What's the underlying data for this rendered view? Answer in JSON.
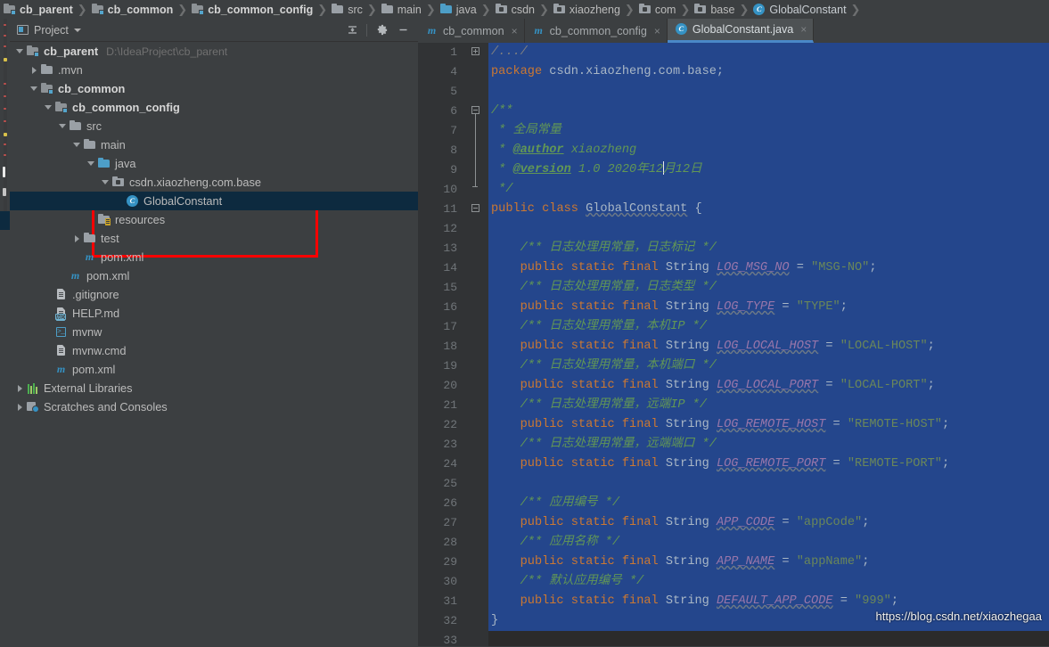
{
  "breadcrumb": {
    "items": [
      {
        "label": "cb_parent",
        "icon": "module-folder-icon",
        "bold": true
      },
      {
        "label": "cb_common",
        "icon": "module-folder-icon",
        "bold": true
      },
      {
        "label": "cb_common_config",
        "icon": "module-folder-icon",
        "bold": true
      },
      {
        "label": "src",
        "icon": "folder-icon",
        "bold": false
      },
      {
        "label": "main",
        "icon": "folder-icon",
        "bold": false
      },
      {
        "label": "java",
        "icon": "source-root-folder-icon",
        "bold": false
      },
      {
        "label": "csdn",
        "icon": "package-icon",
        "bold": false
      },
      {
        "label": "xiaozheng",
        "icon": "package-icon",
        "bold": false
      },
      {
        "label": "com",
        "icon": "package-icon",
        "bold": false
      },
      {
        "label": "base",
        "icon": "package-icon",
        "bold": false
      },
      {
        "label": "GlobalConstant",
        "icon": "class-icon",
        "bold": false
      }
    ],
    "separator": "❯"
  },
  "project_panel": {
    "title": "Project",
    "toolbar": [
      {
        "name": "collapse-all-button",
        "tooltip": "Collapse All"
      },
      {
        "name": "settings-gear-button",
        "tooltip": "Settings"
      },
      {
        "name": "hide-panel-button",
        "tooltip": "Hide"
      }
    ],
    "tree": [
      {
        "label": "cb_parent",
        "secondary": "D:\\IdeaProject\\cb_parent",
        "indent": 0,
        "arrow": "down",
        "icon": "module-folder-icon",
        "bold": true,
        "selected": false
      },
      {
        "label": ".mvn",
        "secondary": "",
        "indent": 1,
        "arrow": "right",
        "icon": "folder-icon",
        "bold": false,
        "selected": false
      },
      {
        "label": "cb_common",
        "secondary": "",
        "indent": 1,
        "arrow": "down",
        "icon": "module-folder-icon",
        "bold": true,
        "selected": false
      },
      {
        "label": "cb_common_config",
        "secondary": "",
        "indent": 2,
        "arrow": "down",
        "icon": "module-folder-icon",
        "bold": true,
        "selected": false
      },
      {
        "label": "src",
        "secondary": "",
        "indent": 3,
        "arrow": "down",
        "icon": "folder-icon",
        "bold": false,
        "selected": false
      },
      {
        "label": "main",
        "secondary": "",
        "indent": 4,
        "arrow": "down",
        "icon": "folder-icon",
        "bold": false,
        "selected": false
      },
      {
        "label": "java",
        "secondary": "",
        "indent": 5,
        "arrow": "down",
        "icon": "source-root-folder-icon",
        "bold": false,
        "selected": false
      },
      {
        "label": "csdn.xiaozheng.com.base",
        "secondary": "",
        "indent": 6,
        "arrow": "down",
        "icon": "package-icon",
        "bold": false,
        "selected": false
      },
      {
        "label": "GlobalConstant",
        "secondary": "",
        "indent": 7,
        "arrow": "none",
        "icon": "class-icon",
        "bold": false,
        "selected": true
      },
      {
        "label": "resources",
        "secondary": "",
        "indent": 5,
        "arrow": "none",
        "icon": "resource-root-folder-icon",
        "bold": false,
        "selected": false
      },
      {
        "label": "test",
        "secondary": "",
        "indent": 4,
        "arrow": "right",
        "icon": "folder-icon",
        "bold": false,
        "selected": false
      },
      {
        "label": "pom.xml",
        "secondary": "",
        "indent": 4,
        "arrow": "none",
        "icon": "maven-xml-icon",
        "bold": false,
        "selected": false
      },
      {
        "label": "pom.xml",
        "secondary": "",
        "indent": 3,
        "arrow": "none",
        "icon": "maven-xml-icon",
        "bold": false,
        "selected": false
      },
      {
        "label": ".gitignore",
        "secondary": "",
        "indent": 2,
        "arrow": "none",
        "icon": "file-icon",
        "bold": false,
        "selected": false
      },
      {
        "label": "HELP.md",
        "secondary": "",
        "indent": 2,
        "arrow": "none",
        "icon": "markdown-file-icon",
        "bold": false,
        "selected": false
      },
      {
        "label": "mvnw",
        "secondary": "",
        "indent": 2,
        "arrow": "none",
        "icon": "shell-script-icon",
        "bold": false,
        "selected": false
      },
      {
        "label": "mvnw.cmd",
        "secondary": "",
        "indent": 2,
        "arrow": "none",
        "icon": "file-icon",
        "bold": false,
        "selected": false
      },
      {
        "label": "pom.xml",
        "secondary": "",
        "indent": 2,
        "arrow": "none",
        "icon": "maven-xml-icon",
        "bold": false,
        "selected": false
      },
      {
        "label": "External Libraries",
        "secondary": "",
        "indent": 0,
        "arrow": "right",
        "icon": "libraries-icon",
        "bold": false,
        "selected": false
      },
      {
        "label": "Scratches and Consoles",
        "secondary": "",
        "indent": 0,
        "arrow": "right",
        "icon": "scratches-icon",
        "bold": false,
        "selected": false
      }
    ],
    "annotation": {
      "color": "#fe0000",
      "shape": "rectangle",
      "name": "red-highlight-box"
    }
  },
  "editor": {
    "tabs": [
      {
        "label": "cb_common",
        "icon": "maven-xml-icon",
        "active": false,
        "close": "×"
      },
      {
        "label": "cb_common_config",
        "icon": "maven-xml-icon",
        "active": false,
        "close": "×"
      },
      {
        "label": "GlobalConstant.java",
        "icon": "class-icon",
        "active": true,
        "close": "×"
      }
    ],
    "line_numbers": [
      1,
      4,
      5,
      6,
      7,
      8,
      9,
      10,
      11,
      12,
      13,
      14,
      15,
      16,
      17,
      18,
      19,
      20,
      21,
      22,
      23,
      24,
      25,
      26,
      27,
      28,
      29,
      30,
      31,
      32,
      33
    ],
    "watermark": "https://blog.csdn.net/xiaozhegaa",
    "selection_color": "#24468c",
    "background_color": "#2b2b2b",
    "source_lines": [
      "/.../",
      "package csdn.xiaozheng.com.base;",
      "",
      "/**",
      " * 全局常量",
      " * @author xiaozheng",
      " * @version 1.0 2020年12月12日",
      " */",
      "public class GlobalConstant {",
      "",
      "    /** 日志处理用常量，日志标记 */",
      "    public static final String LOG_MSG_NO = \"MSG-NO\";",
      "    /** 日志处理用常量，日志类型 */",
      "    public static final String LOG_TYPE = \"TYPE\";",
      "    /** 日志处理用常量，本机IP */",
      "    public static final String LOG_LOCAL_HOST = \"LOCAL-HOST\";",
      "    /** 日志处理用常量，本机端口 */",
      "    public static final String LOG_LOCAL_PORT = \"LOCAL-PORT\";",
      "    /** 日志处理用常量，远端IP */",
      "    public static final String LOG_REMOTE_HOST = \"REMOTE-HOST\";",
      "    /** 日志处理用常量，远端端口 */",
      "    public static final String LOG_REMOTE_PORT = \"REMOTE-PORT\";",
      "",
      "    /** 应用编号 */",
      "    public static final String APP_CODE = \"appCode\";",
      "    /** 应用名称 */",
      "    public static final String APP_NAME = \"appName\";",
      "    /** 默认应用编号 */",
      "    public static final String DEFAULT_APP_CODE = \"999\";",
      "}"
    ]
  }
}
